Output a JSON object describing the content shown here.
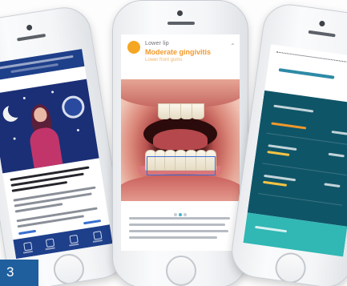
{
  "badge": {
    "number": "3"
  },
  "center_screen": {
    "finding_name": "Lower lip",
    "finding_title": "Moderate gingivitis",
    "finding_subtitle": "Lower front gums"
  },
  "colors": {
    "badge_bg": "#1f5f9e",
    "left_header": "#1e3f8a",
    "finding_accent": "#f29a2e",
    "highlight_box": "#3b6fd6",
    "right_panel": "#0f5568",
    "right_footer": "#31b7b4"
  },
  "icons": [
    "moon-icon",
    "clock-icon",
    "chevron-up-icon",
    "home-tab-icon",
    "calendar-tab-icon",
    "teeth-tab-icon",
    "profile-tab-icon"
  ]
}
